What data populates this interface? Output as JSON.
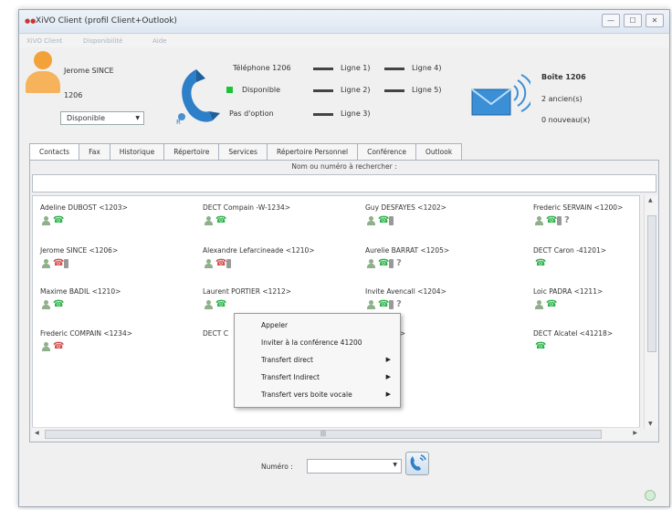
{
  "window": {
    "title": "XiVO Client (profil Client+Outlook)",
    "controls": [
      "—",
      "☐",
      "✕"
    ]
  },
  "menubar": [
    "XiVO Client",
    "Disponibilité",
    "Aide"
  ],
  "identity": {
    "name": "Jerome SINCE",
    "extension": "1206",
    "presence": "Disponible"
  },
  "phone_status": {
    "telephone": "Téléphone 1206",
    "state": "Disponible",
    "option": "Pas d'option",
    "lines": [
      "Ligne 1)",
      "Ligne 2)",
      "Ligne 3)"
    ],
    "extra_lines": [
      "Ligne 4)",
      "Ligne 5)"
    ]
  },
  "mailbox": {
    "title": "Boîte 1206",
    "old": "2 ancien(s)",
    "new": "0 nouveau(x)"
  },
  "tabs": [
    "Contacts",
    "Fax",
    "Historique",
    "Répertoire",
    "Services",
    "Répertoire Personnel",
    "Conférence",
    "Outlook"
  ],
  "search": {
    "hint": "Nom ou numéro à rechercher :"
  },
  "contacts": [
    {
      "name": "Adeline DUBOST <1203>",
      "icons": [
        "person",
        "phone-green"
      ]
    },
    {
      "name": "DECT Compain -W-1234>",
      "icons": [
        "person",
        "phone-green"
      ]
    },
    {
      "name": "Guy DESFAYES <1202>",
      "icons": [
        "person",
        "phone-green",
        "mobile"
      ]
    },
    {
      "name": "Frederic SERVAIN <1200>",
      "icons": [
        "person",
        "phone-green",
        "mobile",
        "unknown"
      ]
    },
    {
      "name": "Jerome SINCE <1206>",
      "icons": [
        "person",
        "phone-red",
        "mobile"
      ]
    },
    {
      "name": "Alexandre Lefarcineade <1210>",
      "icons": [
        "person",
        "phone-red",
        "mobile"
      ]
    },
    {
      "name": "Aurelie BARRAT <1205>",
      "icons": [
        "person",
        "phone-green",
        "mobile",
        "unknown"
      ]
    },
    {
      "name": "DECT Caron -41201>",
      "icons": [
        "phone-green"
      ]
    },
    {
      "name": "Maxime BADIL <1210>",
      "icons": [
        "person",
        "phone-green"
      ]
    },
    {
      "name": "Laurent PORTIER <1212>",
      "icons": [
        "person",
        "phone-green"
      ]
    },
    {
      "name": "Invite Avencall <1204>",
      "icons": [
        "person",
        "phone-green",
        "mobile",
        "unknown"
      ]
    },
    {
      "name": "Loic PADRA <1211>",
      "icons": [
        "person",
        "phone-green"
      ]
    },
    {
      "name": "Frederic COMPAIN <1234>",
      "icons": [
        "person",
        "phone-red"
      ]
    },
    {
      "name": "DECT C",
      "icons": []
    },
    {
      "name": "RE <1288>",
      "icons": []
    },
    {
      "name": "DECT Alcatel <41218>",
      "icons": [
        "phone-green"
      ]
    }
  ],
  "context_menu": [
    {
      "label": "Appeler",
      "submenu": false
    },
    {
      "label": "Inviter à la conférence 41200",
      "submenu": false
    },
    {
      "label": "Transfert direct",
      "submenu": true
    },
    {
      "label": "Transfert Indirect",
      "submenu": true
    },
    {
      "label": "Transfert vers boite vocale",
      "submenu": true
    }
  ],
  "bottom": {
    "number_label": "Numéro :",
    "number_value": ""
  },
  "colors": {
    "available": "#1fc33a",
    "phone_green": "#2fb24c",
    "phone_red": "#d55050",
    "avatar": "#f3a23a"
  }
}
